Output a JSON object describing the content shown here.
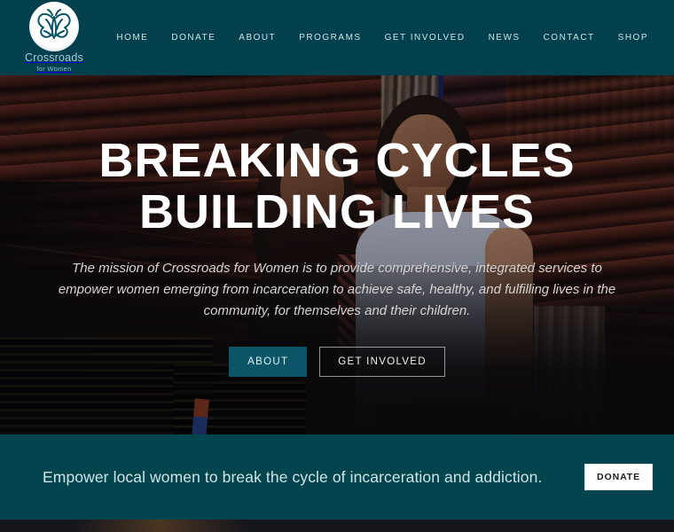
{
  "header": {
    "logo": {
      "icon": "butterfly-logo-icon",
      "name": "Crossroads",
      "subtitle": "for Women"
    },
    "nav": [
      {
        "label": "HOME",
        "name": "nav-link-home"
      },
      {
        "label": "DONATE",
        "name": "nav-link-donate"
      },
      {
        "label": "ABOUT",
        "name": "nav-link-about"
      },
      {
        "label": "PROGRAMS",
        "name": "nav-link-programs"
      },
      {
        "label": "GET INVOLVED",
        "name": "nav-link-get-involved"
      },
      {
        "label": "NEWS",
        "name": "nav-link-news"
      },
      {
        "label": "CONTACT",
        "name": "nav-link-contact"
      },
      {
        "label": "SHOP",
        "name": "nav-link-shop"
      }
    ]
  },
  "hero": {
    "title_line1": "BREAKING CYCLES",
    "title_line2": "BUILDING LIVES",
    "mission": "The mission of Crossroads for Women is to provide comprehensive, integrated services to empower women emerging from incarceration to achieve safe, healthy, and fulfilling lives in the community, for themselves and their children.",
    "primary_button": "ABOUT",
    "secondary_button": "GET INVOLVED"
  },
  "cta": {
    "text": "Empower local women to break the cycle of incarceration and addiction.",
    "button": "DONATE"
  },
  "colors": {
    "header_teal": "#02404e",
    "cta_teal": "#02454f",
    "button_teal": "#0c5568",
    "nav_text": "#cfe4e8",
    "cta_text": "#cfe3e7",
    "donate_button_bg": "#ffffff"
  }
}
